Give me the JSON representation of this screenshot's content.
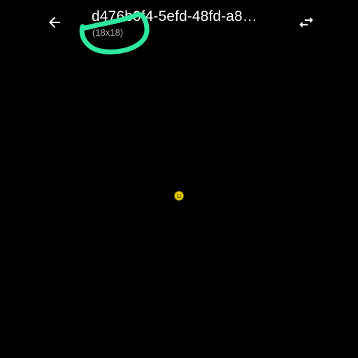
{
  "header": {
    "title": "d476b0f4-5efd-48fd-a8…",
    "dimensions": "(18x18)",
    "back_icon": "arrow-left-icon",
    "swap_icon": "swap-horizontal-icon"
  },
  "image": {
    "width": 18,
    "height": 18,
    "description_icon": "smiley-icon"
  },
  "colors": {
    "background": "#000000",
    "title_text": "#ffffff",
    "subtitle_text": "#b0b0b0",
    "annotation_stroke": "#2ee8a0",
    "emoji_fill": "#e8d000"
  }
}
